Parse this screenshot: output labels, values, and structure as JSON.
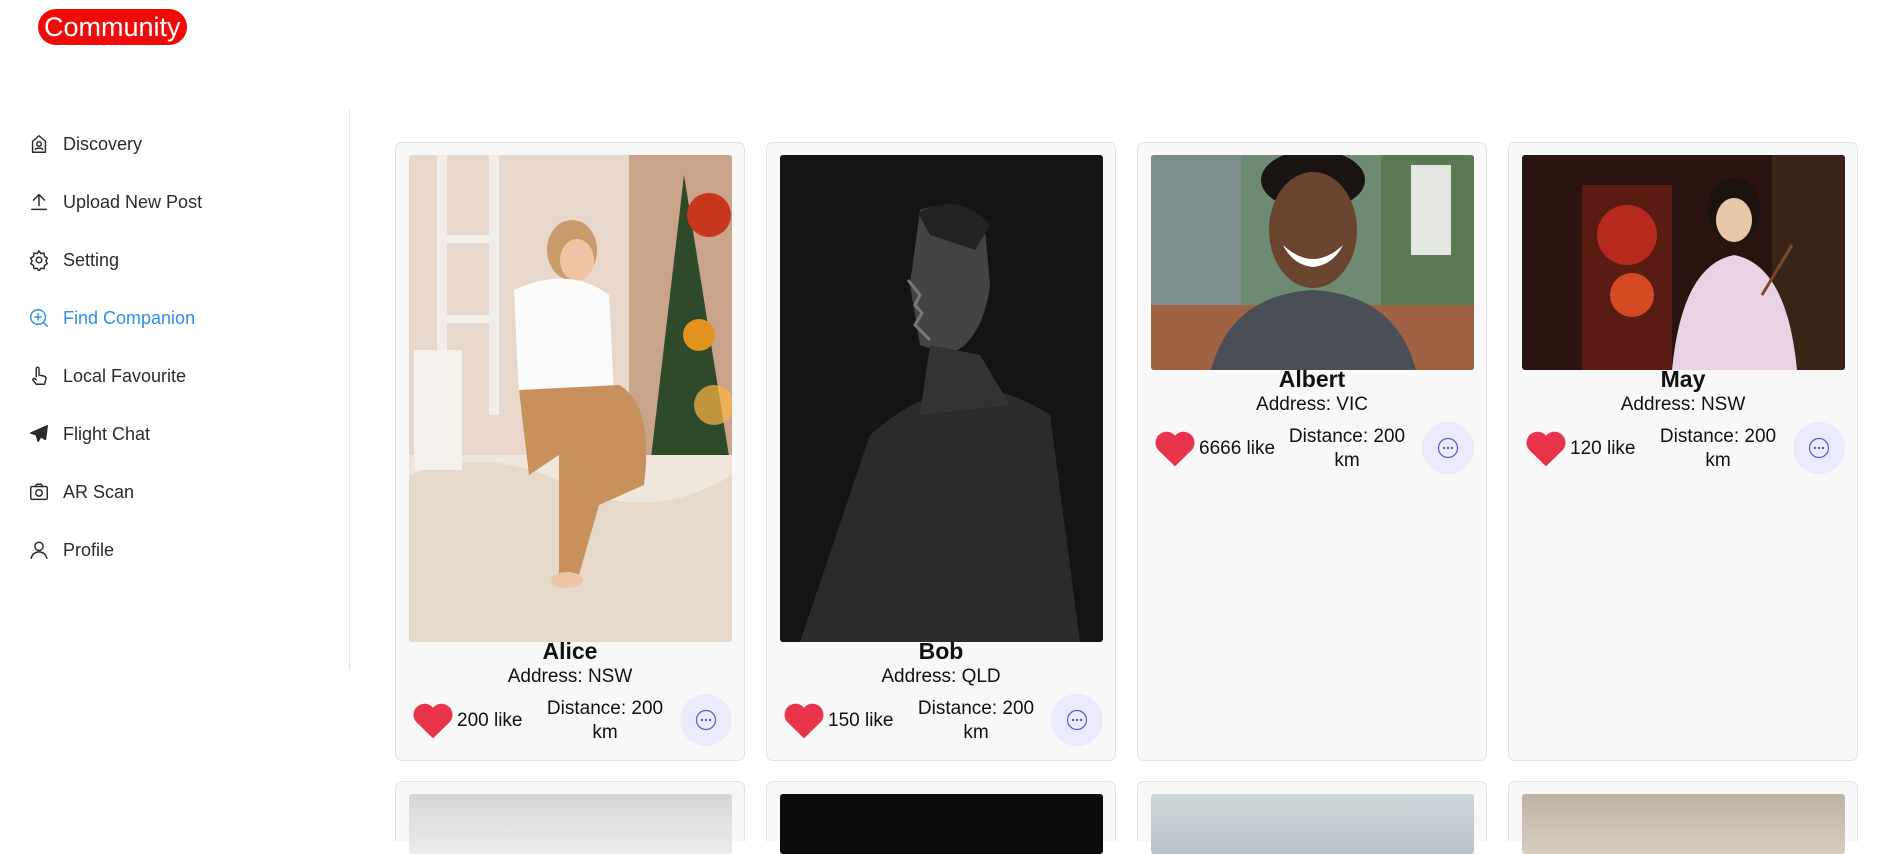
{
  "app": {
    "logo": "Community",
    "brand_color": "#f00b0b",
    "active_color": "#2e8fe6"
  },
  "sidebar": {
    "items": [
      {
        "label": "Discovery",
        "icon": "home-badge-icon",
        "active": false
      },
      {
        "label": "Upload New Post",
        "icon": "upload-icon",
        "active": false
      },
      {
        "label": "Setting",
        "icon": "gear-icon",
        "active": false
      },
      {
        "label": "Find Companion",
        "icon": "search-plus-icon",
        "active": true
      },
      {
        "label": "Local Favourite",
        "icon": "hand-pointer-icon",
        "active": false
      },
      {
        "label": "Flight Chat",
        "icon": "paper-plane-icon",
        "active": false
      },
      {
        "label": "AR Scan",
        "icon": "camera-icon",
        "active": false
      },
      {
        "label": "Profile",
        "icon": "user-icon",
        "active": false
      }
    ]
  },
  "cards": [
    {
      "name": "Alice",
      "address": "Address: NSW",
      "likes": "200 like",
      "distance": "Distance: 200 km",
      "photo": "woman seated on blanket by christmas tree"
    },
    {
      "name": "Bob",
      "address": "Address: QLD",
      "likes": "150 like",
      "distance": "Distance: 200 km",
      "photo": "man in profile, black and white"
    },
    {
      "name": "Albert",
      "address": "Address: VIC",
      "likes": "6666 like",
      "distance": "Distance: 200 km",
      "photo": "smiling man outdoors"
    },
    {
      "name": "May",
      "address": "Address: NSW",
      "likes": "120 like",
      "distance": "Distance: 200 km",
      "photo": "woman in pink jacket by red shrine"
    }
  ],
  "icons": {
    "like": "heart-icon",
    "chat": "chat-bubble-icon",
    "heart_color": "#e8344a"
  }
}
